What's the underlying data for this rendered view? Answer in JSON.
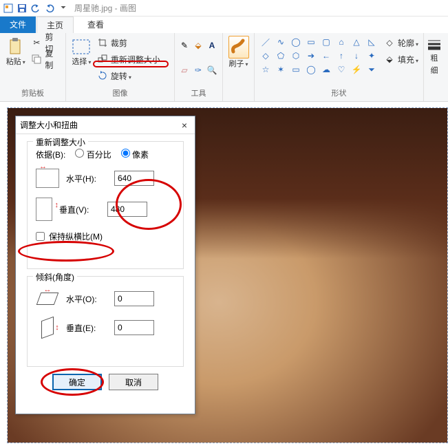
{
  "window": {
    "title": "周星驰.jpg - 画图",
    "app_icon": "paint-icon"
  },
  "qat": {
    "save": "save-icon",
    "undo": "undo-icon",
    "redo": "redo-icon"
  },
  "tabs": {
    "file": "文件",
    "home": "主页",
    "view": "查看"
  },
  "ribbon": {
    "clipboard": {
      "label": "剪贴板",
      "paste": "粘贴",
      "cut": "剪切",
      "copy": "复制"
    },
    "image": {
      "label": "图像",
      "select": "选择",
      "crop": "裁剪",
      "resize": "重新调整大小",
      "rotate": "旋转"
    },
    "tools": {
      "label": "工具",
      "pencil": "pencil-icon",
      "fill": "fill-icon",
      "text": "A",
      "eraser": "eraser-icon",
      "picker": "picker-icon",
      "zoom": "zoom-icon"
    },
    "brushes": {
      "label": "刷子"
    },
    "shapes": {
      "label": "形状",
      "outline": "轮廓",
      "fill": "填充"
    },
    "size_thick": {
      "thick": "粗",
      "thin": "细"
    }
  },
  "dialog": {
    "title": "调整大小和扭曲",
    "close": "×",
    "resize_legend": "重新调整大小",
    "basis_label": "依据(B):",
    "percent": "百分比",
    "pixels": "像素",
    "h_label": "水平(H):",
    "v_label": "垂直(V):",
    "h_value": "640",
    "v_value": "480",
    "aspect_label": "保持纵横比(M)",
    "aspect_checked": false,
    "selected_basis": "pixels",
    "skew_legend": "倾斜(角度)",
    "skew_h_label": "水平(O):",
    "skew_v_label": "垂直(E):",
    "skew_h_value": "0",
    "skew_v_value": "0",
    "ok": "确定",
    "cancel": "取消"
  },
  "annotations": {
    "resize_button_highlight": true,
    "hv_values_highlight": true,
    "aspect_highlight": true,
    "ok_highlight": true
  }
}
